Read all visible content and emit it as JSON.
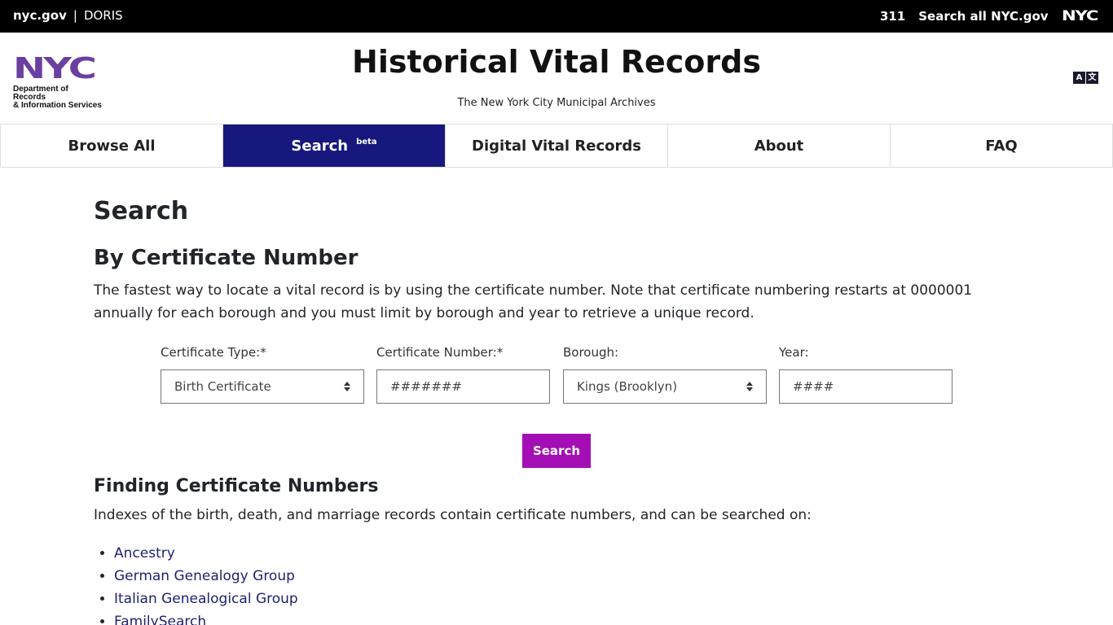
{
  "topbar": {
    "nycgov": "nyc.gov",
    "separator": "|",
    "doris": "DORIS",
    "r311": "311",
    "search_all": "Search all NYC.gov",
    "nyc_logo": "NYC"
  },
  "header": {
    "logo_nyc": "NYC",
    "logo_dept_line1": "Department of Records",
    "logo_dept_line2": "& Information Services",
    "title": "Historical Vital Records",
    "subtitle": "The New York City Municipal Archives",
    "translate_icon_a": "A",
    "translate_icon_b": "文"
  },
  "nav": {
    "items": [
      {
        "label": "Browse All",
        "active": false
      },
      {
        "label": "Search",
        "badge": "beta",
        "active": true
      },
      {
        "label": "Digital Vital Records",
        "active": false
      },
      {
        "label": "About",
        "active": false
      },
      {
        "label": "FAQ",
        "active": false
      }
    ]
  },
  "main": {
    "page_title": "Search",
    "section_title": "By Certificate Number",
    "intro": "The fastest way to locate a vital record is by using the certificate number. Note that certificate numbering restarts at 0000001 annually for each borough and you must limit by borough and year to retrieve a unique record.",
    "form": {
      "certificate_type": {
        "label": "Certificate Type:*",
        "value": "Birth Certificate"
      },
      "certificate_number": {
        "label": "Certificate Number:*",
        "placeholder": "#######",
        "value": ""
      },
      "borough": {
        "label": "Borough:",
        "value": "Kings (Brooklyn)"
      },
      "year": {
        "label": "Year:",
        "placeholder": "####",
        "value": ""
      },
      "submit_label": "Search"
    },
    "finding": {
      "title": "Finding Certificate Numbers",
      "text": "Indexes of the birth, death, and marriage records contain certificate numbers, and can be searched on:",
      "links": [
        "Ancestry",
        "German Genealogy Group",
        "Italian Genealogical Group",
        "FamilySearch"
      ]
    }
  },
  "colors": {
    "nav_active": "#17187d",
    "search_button": "#a30fb5",
    "logo_purple": "#6b3fa0",
    "link": "#1e2370"
  }
}
